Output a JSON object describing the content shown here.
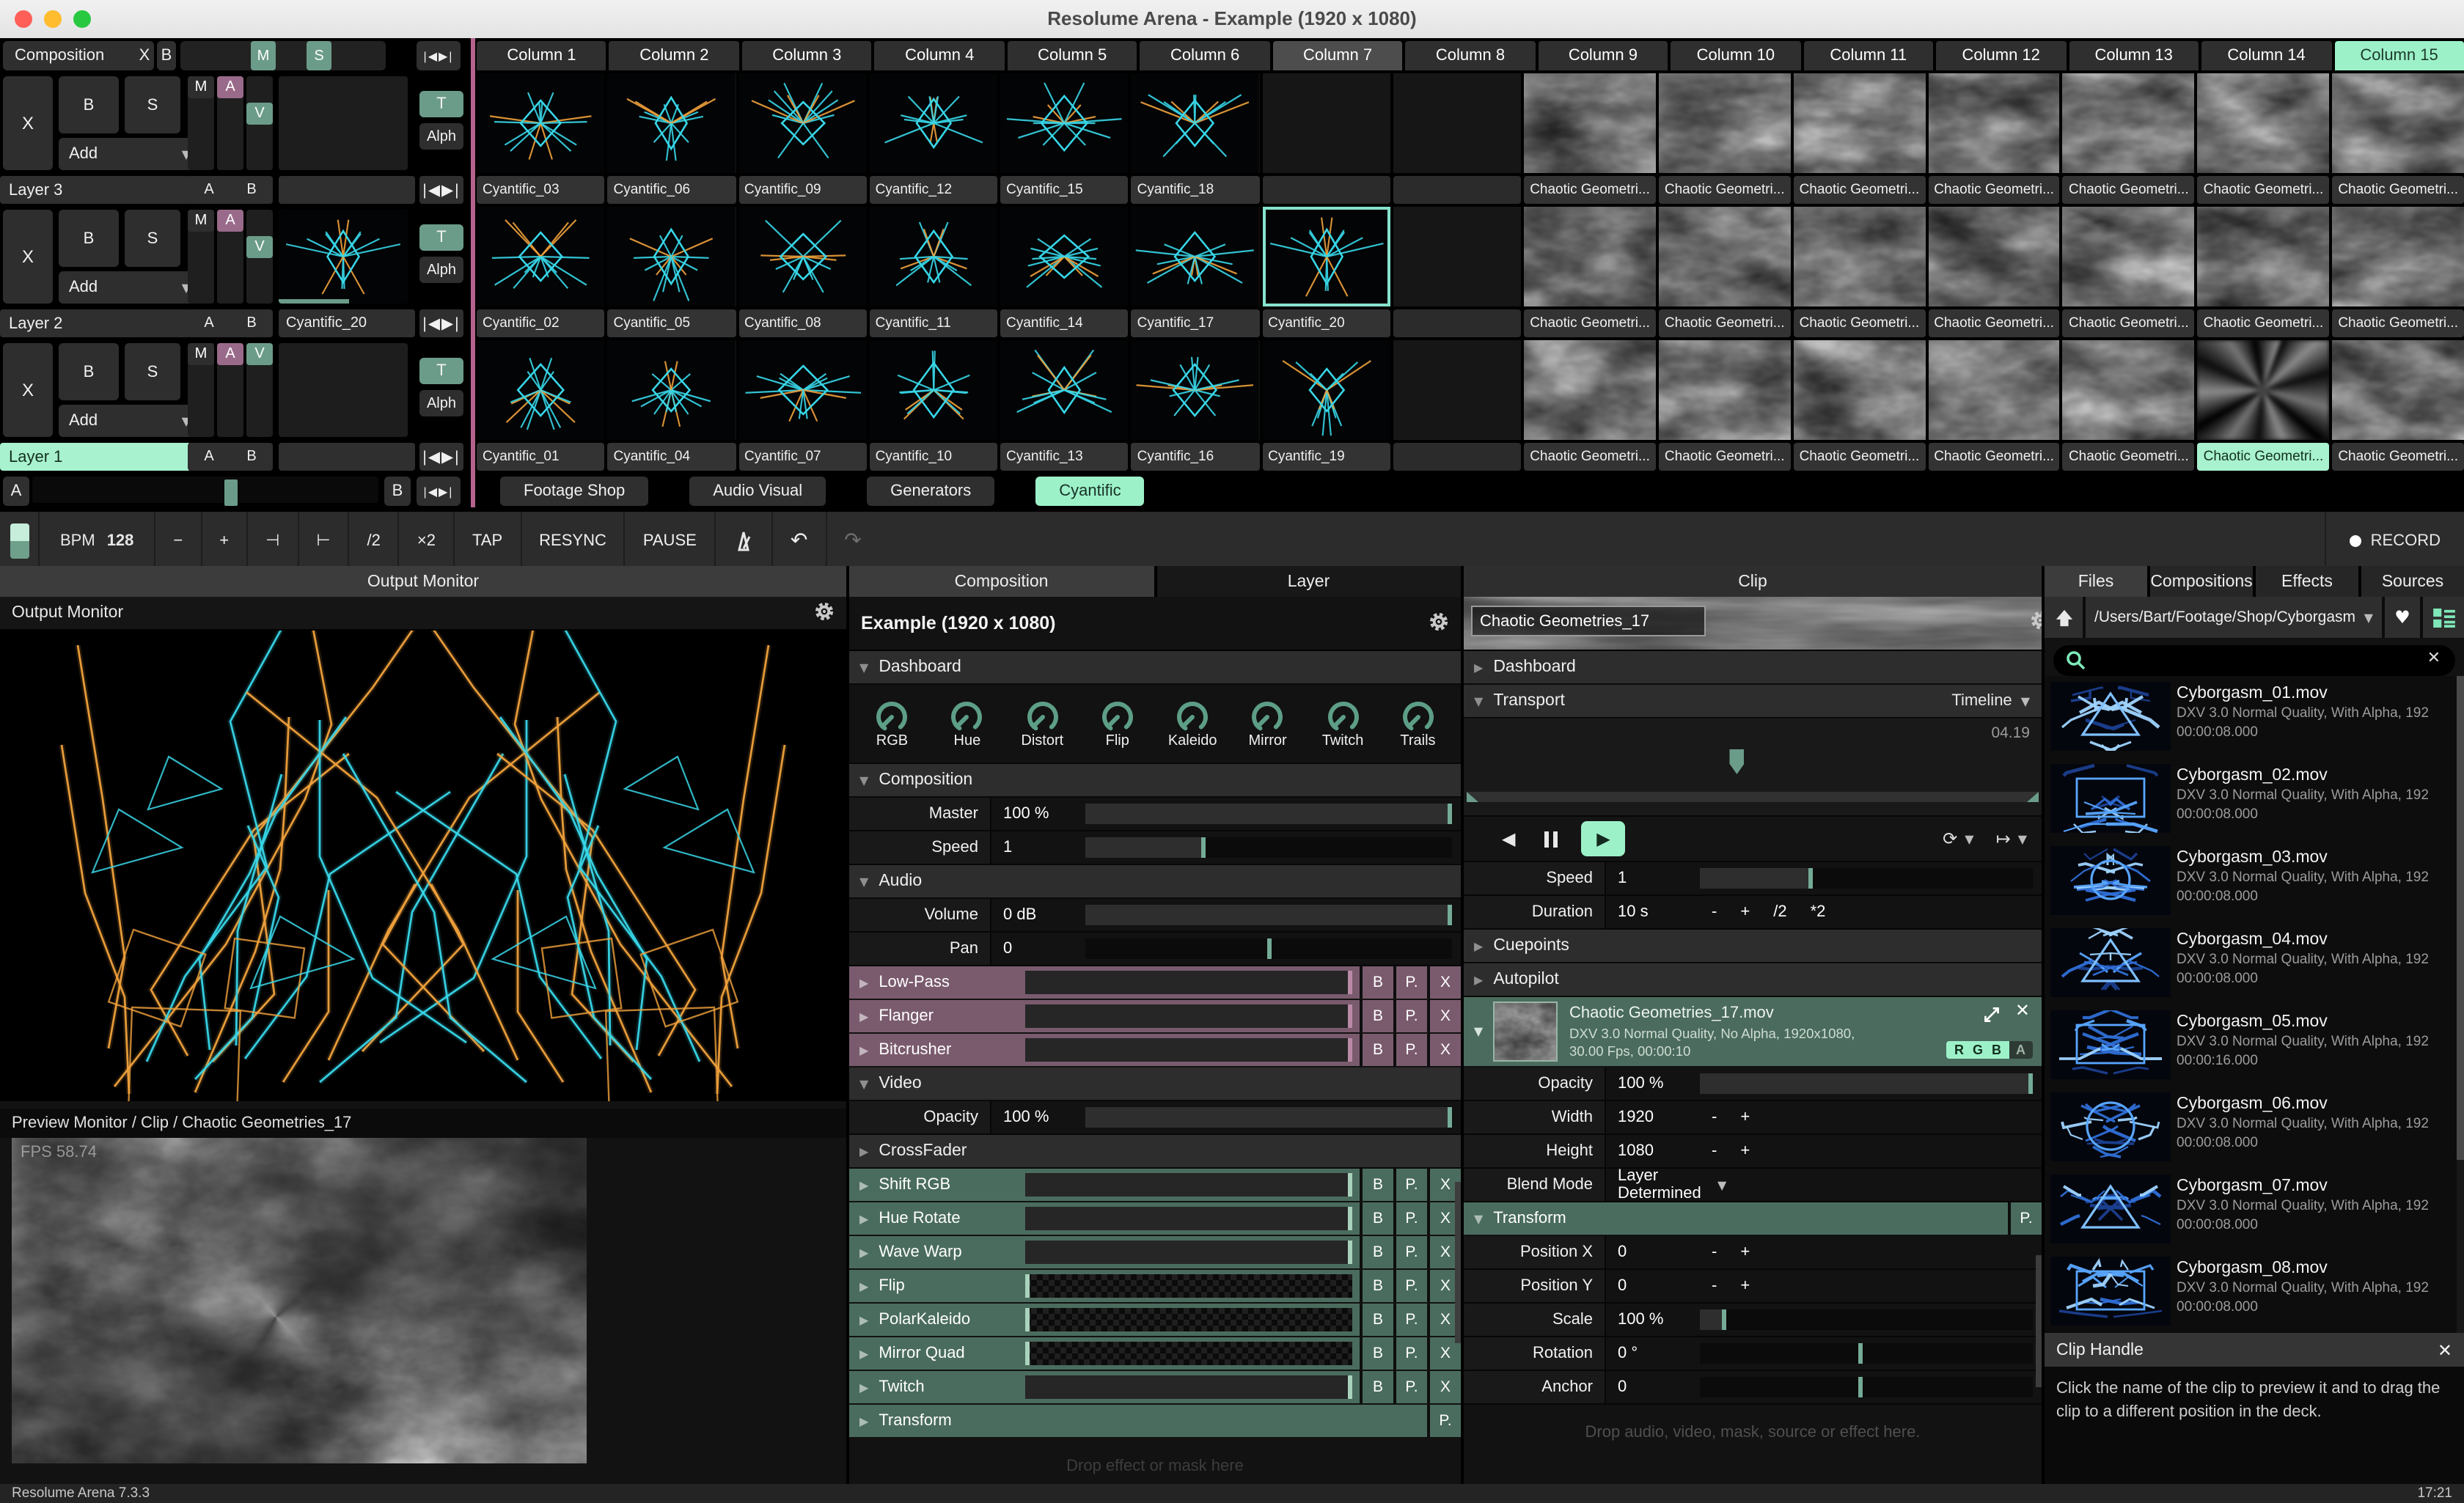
{
  "window": {
    "title": "Resolume Arena - Example (1920 x 1080)",
    "status_left": "Resolume Arena 7.3.3",
    "status_right": "17:21"
  },
  "colors": {
    "mint": "#9df1c9",
    "teal": "#6b9c89",
    "purple_chip": "#9a6a8a",
    "mauve_fx": "#7a5b6e",
    "green_fx": "#4a6c5e",
    "pink_divider": "#b4638e",
    "clip_cyan": "#38d6e8",
    "clip_orange": "#f0a13c",
    "file_blue": "#58a6ff"
  },
  "header": {
    "tab": "Composition",
    "close": "X",
    "bypass": "B",
    "master": "M",
    "solo": "S",
    "prev": "|◀",
    "next": "▶|"
  },
  "columns": {
    "labels": [
      "Column 1",
      "Column 2",
      "Column 3",
      "Column 4",
      "Column 5",
      "Column 6",
      "Column 7",
      "Column 8",
      "Column 9",
      "Column 10",
      "Column 11",
      "Column 12",
      "Column 13",
      "Column 14",
      "Column 15"
    ],
    "active": 6,
    "highlighted": 14
  },
  "layers": [
    {
      "name": "Layer 3",
      "clear": "X",
      "bypass": "B",
      "solo": "S",
      "blend": "Add",
      "m": "M",
      "a": "A",
      "v": "V",
      "t": "T",
      "alph": "Alph",
      "ab": [
        "A",
        "B"
      ],
      "selected": false,
      "clip": "",
      "v_top": false,
      "progress": 0
    },
    {
      "name": "Layer 2",
      "clear": "X",
      "bypass": "B",
      "solo": "S",
      "blend": "Add",
      "m": "M",
      "a": "A",
      "v": "V",
      "t": "T",
      "alph": "Alph",
      "ab": [
        "A",
        "B"
      ],
      "selected": false,
      "clip": "Cyantific_20",
      "v_top": false,
      "progress": 55
    },
    {
      "name": "Layer 1",
      "clear": "X",
      "bypass": "B",
      "solo": "S",
      "blend": "Add",
      "m": "M",
      "a": "A",
      "v": "V",
      "t": "T",
      "alph": "Alph",
      "ab": [
        "A",
        "B"
      ],
      "selected": true,
      "clip": "",
      "v_top": true,
      "progress": 0
    }
  ],
  "crossfader": {
    "a": "A",
    "b": "B"
  },
  "decks": {
    "tabs": [
      "Footage Shop",
      "Audio Visual",
      "Generators",
      "Cyantific"
    ],
    "active": 3
  },
  "toolbar": {
    "bpm_label": "BPM",
    "bpm_value": "128",
    "minus": "−",
    "plus": "+",
    "nudge_down": "⊣",
    "nudge_up": "⊢",
    "half": "/2",
    "double": "×2",
    "tap": "TAP",
    "resync": "RESYNC",
    "pause": "PAUSE",
    "record": "RECORD"
  },
  "grid": {
    "rows": [
      [
        {
          "l": "Cyantific_03",
          "a": "cyan",
          "s": 3
        },
        {
          "l": "Cyantific_06",
          "a": "cyan",
          "s": 6
        },
        {
          "l": "Cyantific_09",
          "a": "cyan",
          "s": 9
        },
        {
          "l": "Cyantific_12",
          "a": "cyan",
          "s": 12
        },
        {
          "l": "Cyantific_15",
          "a": "cyan",
          "s": 15
        },
        {
          "l": "Cyantific_18",
          "a": "cyan",
          "s": 18
        },
        {
          "l": "",
          "a": "",
          "s": 0
        },
        {
          "l": "",
          "a": "",
          "s": 0
        },
        {
          "l": "Chaotic Geometri...",
          "a": "gray",
          "s": 11
        },
        {
          "l": "Chaotic Geometri...",
          "a": "gray",
          "s": 12
        },
        {
          "l": "Chaotic Geometri...",
          "a": "gray",
          "s": 13
        },
        {
          "l": "Chaotic Geometri...",
          "a": "gray",
          "s": 14
        },
        {
          "l": "Chaotic Geometri...",
          "a": "gray",
          "s": 15
        },
        {
          "l": "Chaotic Geometri...",
          "a": "gray",
          "s": 16
        },
        {
          "l": "Chaotic Geometri...",
          "a": "gray",
          "s": 17
        }
      ],
      [
        {
          "l": "Cyantific_02",
          "a": "cyan",
          "s": 2
        },
        {
          "l": "Cyantific_05",
          "a": "cyan",
          "s": 5
        },
        {
          "l": "Cyantific_08",
          "a": "cyan",
          "s": 8
        },
        {
          "l": "Cyantific_11",
          "a": "cyan",
          "s": 11
        },
        {
          "l": "Cyantific_14",
          "a": "cyan",
          "s": 14
        },
        {
          "l": "Cyantific_17",
          "a": "cyan",
          "s": 17
        },
        {
          "l": "Cyantific_20",
          "a": "cyan",
          "s": 20,
          "st": "active"
        },
        {
          "l": "",
          "a": "",
          "s": 0
        },
        {
          "l": "Chaotic Geometri...",
          "a": "gray",
          "s": 21
        },
        {
          "l": "Chaotic Geometri...",
          "a": "gray",
          "s": 22
        },
        {
          "l": "Chaotic Geometri...",
          "a": "gray",
          "s": 23
        },
        {
          "l": "Chaotic Geometri...",
          "a": "gray",
          "s": 24
        },
        {
          "l": "Chaotic Geometri...",
          "a": "gray",
          "s": 25
        },
        {
          "l": "Chaotic Geometri...",
          "a": "gray",
          "s": 26
        },
        {
          "l": "Chaotic Geometri...",
          "a": "gray",
          "s": 27
        }
      ],
      [
        {
          "l": "Cyantific_01",
          "a": "cyan",
          "s": 1
        },
        {
          "l": "Cyantific_04",
          "a": "cyan",
          "s": 4
        },
        {
          "l": "Cyantific_07",
          "a": "cyan",
          "s": 7
        },
        {
          "l": "Cyantific_10",
          "a": "cyan",
          "s": 10
        },
        {
          "l": "Cyantific_13",
          "a": "cyan",
          "s": 13
        },
        {
          "l": "Cyantific_16",
          "a": "cyan",
          "s": 16
        },
        {
          "l": "Cyantific_19",
          "a": "cyan",
          "s": 19
        },
        {
          "l": "",
          "a": "",
          "s": 0
        },
        {
          "l": "Chaotic Geometri...",
          "a": "gray",
          "s": 31
        },
        {
          "l": "Chaotic Geometri...",
          "a": "gray",
          "s": 32
        },
        {
          "l": "Chaotic Geometri...",
          "a": "gray",
          "s": 33
        },
        {
          "l": "Chaotic Geometri...",
          "a": "gray",
          "s": 34
        },
        {
          "l": "Chaotic Geometri...",
          "a": "gray",
          "s": 35
        },
        {
          "l": "Chaotic Geometri...",
          "a": "swirl",
          "s": 36,
          "st": "selected"
        },
        {
          "l": "Chaotic Geometri...",
          "a": "gray",
          "s": 37
        }
      ]
    ]
  },
  "output": {
    "tab": "Output Monitor",
    "label": "Output Monitor",
    "preview_label": "Preview Monitor / Clip / Chaotic Geometries_17",
    "fps": "FPS 58.74"
  },
  "composition": {
    "tabs": [
      "Composition",
      "Layer"
    ],
    "title": "Example (1920 x 1080)",
    "dashboard": {
      "label": "Dashboard",
      "knobs": [
        "RGB",
        "Hue",
        "Distort",
        "Flip",
        "Kaleido",
        "Mirror",
        "Twitch",
        "Trails"
      ]
    },
    "sections": {
      "composition": "Composition",
      "audio": "Audio",
      "video": "Video",
      "crossfader": "CrossFader"
    },
    "params": {
      "master": {
        "label": "Master",
        "value": "100 %"
      },
      "speed": {
        "label": "Speed",
        "value": "1"
      },
      "volume": {
        "label": "Volume",
        "value": "0 dB"
      },
      "pan": {
        "label": "Pan",
        "value": "0"
      },
      "opacity": {
        "label": "Opacity",
        "value": "100 %"
      }
    },
    "audio_effects": [
      "Low-Pass",
      "Flanger",
      "Bitcrusher"
    ],
    "video_effects": [
      "Shift RGB",
      "Hue Rotate",
      "Wave Warp",
      "Flip",
      "PolarKaleido",
      "Mirror Quad",
      "Twitch"
    ],
    "transform_label": "Transform",
    "fx_buttons": {
      "bypass": "B",
      "preset": "P.",
      "close": "X"
    },
    "drop_hint": "Drop effect or mask here"
  },
  "clip": {
    "tab": "Clip",
    "name": "Chaotic Geometries_17",
    "dashboard": "Dashboard",
    "transport": {
      "label": "Transport",
      "mode": "Timeline",
      "time": "04.19"
    },
    "cuepoints": "Cuepoints",
    "autopilot": "Autopilot",
    "params": {
      "speed": {
        "label": "Speed",
        "value": "1"
      },
      "duration": {
        "label": "Duration",
        "value": "10 s",
        "buttons": [
          "-",
          "+",
          "/2",
          "*2"
        ]
      },
      "opacity": {
        "label": "Opacity",
        "value": "100 %"
      },
      "width": {
        "label": "Width",
        "value": "1920",
        "buttons": [
          "-",
          "+"
        ]
      },
      "height": {
        "label": "Height",
        "value": "1080",
        "buttons": [
          "-",
          "+"
        ]
      },
      "blend": {
        "label": "Blend Mode",
        "value": "Layer Determined"
      },
      "posx": {
        "label": "Position X",
        "value": "0",
        "buttons": [
          "-",
          "+"
        ]
      },
      "posy": {
        "label": "Position Y",
        "value": "0",
        "buttons": [
          "-",
          "+"
        ]
      },
      "scale": {
        "label": "Scale",
        "value": "100 %"
      },
      "rotation": {
        "label": "Rotation",
        "value": "0 °"
      },
      "anchor": {
        "label": "Anchor",
        "value": "0"
      }
    },
    "file": {
      "name": "Chaotic Geometries_17.mov",
      "meta": "DXV 3.0 Normal Quality, No Alpha, 1920x1080,",
      "meta2": "30.00 Fps, 00:00:10",
      "channels": [
        "R",
        "G",
        "B",
        "A"
      ]
    },
    "transform_label": "Transform",
    "drop_hint": "Drop audio, video, mask, source or effect here."
  },
  "files": {
    "tabs": [
      "Files",
      "Compositions",
      "Effects",
      "Sources"
    ],
    "active_tab": 0,
    "path": "/Users/Bart/Footage/Shop/Cyborgasm",
    "items": [
      {
        "name": "Cyborgasm_01.mov",
        "meta": "DXV 3.0 Normal Quality, With Alpha, 192",
        "duration": "00:00:08.000"
      },
      {
        "name": "Cyborgasm_02.mov",
        "meta": "DXV 3.0 Normal Quality, With Alpha, 192",
        "duration": "00:00:08.000"
      },
      {
        "name": "Cyborgasm_03.mov",
        "meta": "DXV 3.0 Normal Quality, With Alpha, 192",
        "duration": "00:00:08.000"
      },
      {
        "name": "Cyborgasm_04.mov",
        "meta": "DXV 3.0 Normal Quality, With Alpha, 192",
        "duration": "00:00:08.000"
      },
      {
        "name": "Cyborgasm_05.mov",
        "meta": "DXV 3.0 Normal Quality, With Alpha, 192",
        "duration": "00:00:16.000"
      },
      {
        "name": "Cyborgasm_06.mov",
        "meta": "DXV 3.0 Normal Quality, With Alpha, 192",
        "duration": "00:00:08.000"
      },
      {
        "name": "Cyborgasm_07.mov",
        "meta": "DXV 3.0 Normal Quality, With Alpha, 192",
        "duration": "00:00:08.000"
      },
      {
        "name": "Cyborgasm_08.mov",
        "meta": "DXV 3.0 Normal Quality, With Alpha, 192",
        "duration": "00:00:08.000"
      }
    ],
    "clip_handle": {
      "title": "Clip Handle",
      "text": "Click the name of the clip to preview it and to drag the clip to a different position in the deck."
    }
  }
}
